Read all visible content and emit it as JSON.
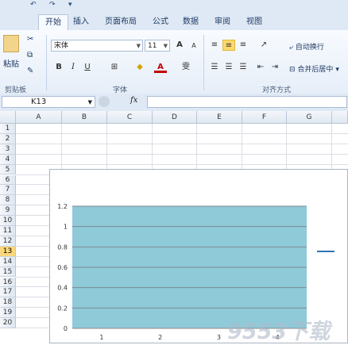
{
  "ribbon_tabs": [
    "开始",
    "插入",
    "页面布局",
    "公式",
    "数据",
    "审阅",
    "视图"
  ],
  "clipboard": {
    "paste": "粘贴",
    "group": "剪贴板"
  },
  "font": {
    "name": "宋体",
    "size": "11",
    "group": "字体",
    "bold": "B",
    "italic": "I",
    "underline": "U",
    "grow": "A",
    "shrink": "A",
    "font_color": "A",
    "phonetic": "雯"
  },
  "alignment": {
    "wrap": "自动换行",
    "merge": "合并后居中",
    "group": "对齐方式"
  },
  "formula_bar": {
    "cell_ref": "K13",
    "fx": "fx",
    "formula": ""
  },
  "columns": [
    "A",
    "B",
    "C",
    "D",
    "E",
    "F",
    "G"
  ],
  "rows": [
    "1",
    "2",
    "3",
    "4",
    "5",
    "6",
    "7",
    "8",
    "9",
    "10",
    "11",
    "12",
    "13",
    "14",
    "15",
    "16",
    "17",
    "18",
    "19",
    "20"
  ],
  "selected_row": "13",
  "colors": {
    "accent": "#f9d77a",
    "plot_fill": "#8fcad9",
    "legend_line": "#2e75b6"
  },
  "chart_data": {
    "type": "area",
    "x": [
      "1",
      "2",
      "3",
      "4"
    ],
    "series": [
      {
        "values": [
          1.2,
          1.2,
          1.2,
          1.2
        ]
      }
    ],
    "ylim": [
      0,
      1.2
    ],
    "yticks": [
      "0",
      "0.2",
      "0.4",
      "0.6",
      "0.8",
      "1",
      "1.2"
    ],
    "grid": true,
    "legend": "right"
  },
  "watermark": "9553下载"
}
